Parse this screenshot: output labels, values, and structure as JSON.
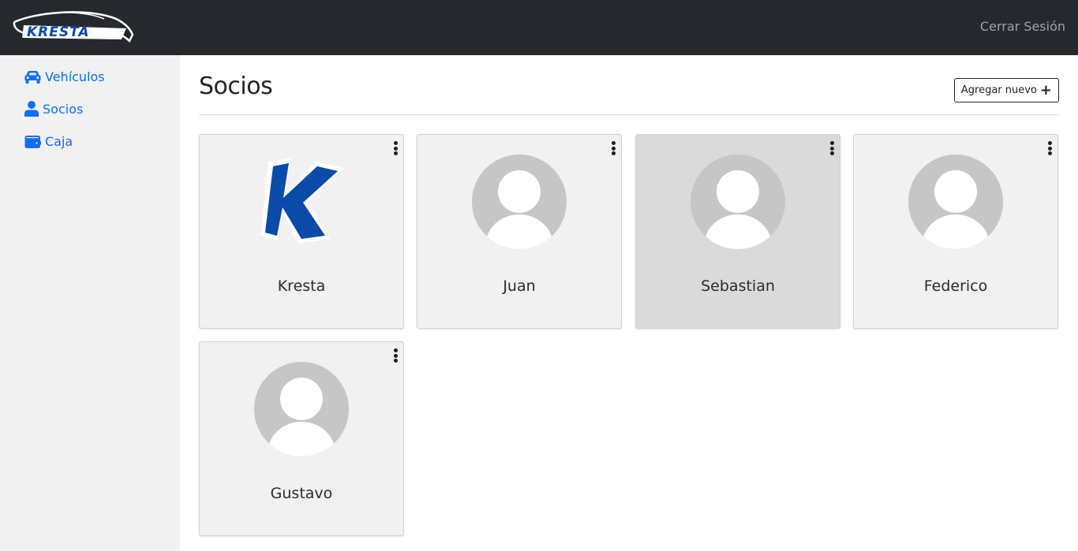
{
  "header": {
    "logo_text": "KRESTA",
    "logout_label": "Cerrar Sesión"
  },
  "sidebar": {
    "items": [
      {
        "label": "Vehículos",
        "icon": "car-icon"
      },
      {
        "label": "Socios",
        "icon": "user-icon"
      },
      {
        "label": "Caja",
        "icon": "wallet-icon"
      }
    ]
  },
  "main": {
    "title": "Socios",
    "add_button_label": "Agregar nuevo",
    "add_button_icon": "plus-icon",
    "partners": [
      {
        "name": "Kresta",
        "avatar": "kresta-logo"
      },
      {
        "name": "Juan",
        "avatar": "default-avatar-icon"
      },
      {
        "name": "Sebastian",
        "avatar": "default-avatar-icon"
      },
      {
        "name": "Federico",
        "avatar": "default-avatar-icon"
      },
      {
        "name": "Gustavo",
        "avatar": "default-avatar-icon"
      }
    ]
  },
  "colors": {
    "topbar": "#25282d",
    "sidebar": "#f1f1f1",
    "link": "#0d6efd",
    "card": "#f1f1f1",
    "card_hover": "#dadada",
    "avatar_bg": "#c6c6c6",
    "brand_blue": "#0a4aa8"
  }
}
